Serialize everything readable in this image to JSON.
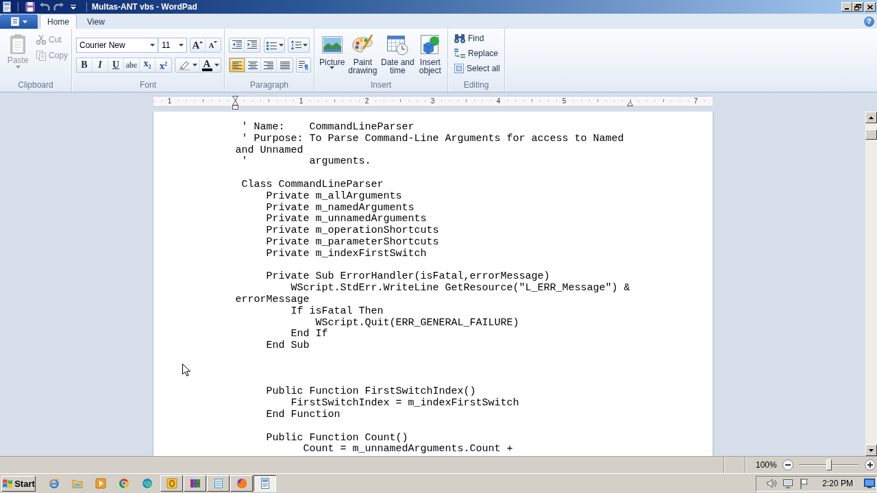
{
  "window": {
    "title": "Multas-ANT vbs - WordPad"
  },
  "quick_access": [
    {
      "kind": "save",
      "disabled": false
    },
    {
      "kind": "undo",
      "disabled": true
    },
    {
      "kind": "redo",
      "disabled": true
    }
  ],
  "ribbon": {
    "tabs": [
      {
        "label": "Home",
        "selected": true
      },
      {
        "label": "View",
        "selected": false
      }
    ],
    "help": "?",
    "clipboard": {
      "label": "Clipboard",
      "paste": {
        "label": "Paste",
        "disabled": true
      },
      "items": [
        {
          "kind": "cut",
          "label": "Cut",
          "disabled": true
        },
        {
          "kind": "copy",
          "label": "Copy",
          "disabled": true
        }
      ]
    },
    "font": {
      "label": "Font",
      "family": "Courier New",
      "size": "11",
      "grow_font": "A",
      "shrink_font": "A",
      "styles": [
        {
          "kind": "bold",
          "label": "B"
        },
        {
          "kind": "italic",
          "label": "I"
        },
        {
          "kind": "underline",
          "label": "U"
        },
        {
          "kind": "strike",
          "label": "abc"
        },
        {
          "kind": "subscript",
          "label": "x$_{2}$"
        },
        {
          "kind": "superscript",
          "label": "x$^{2}$"
        }
      ],
      "font_color": "A"
    },
    "paragraph": {
      "label": "Paragraph",
      "alignments": [
        {
          "kind": "left",
          "selected": true
        },
        {
          "kind": "center",
          "selected": false
        },
        {
          "kind": "right",
          "selected": false
        },
        {
          "kind": "justify",
          "selected": false
        }
      ]
    },
    "insert": {
      "label": "Insert",
      "items": [
        {
          "kind": "picture",
          "label": "Picture"
        },
        {
          "kind": "paint",
          "label": "Paint drawing"
        },
        {
          "kind": "datetime",
          "label": "Date and time"
        },
        {
          "kind": "object",
          "label": "Insert object"
        }
      ]
    },
    "editing": {
      "label": "Editing",
      "items": [
        {
          "kind": "find",
          "label": "Find"
        },
        {
          "kind": "replace",
          "label": "Replace"
        },
        {
          "kind": "select_all",
          "label": "Select all"
        }
      ]
    }
  },
  "ruler": {
    "marks": [
      "1",
      "1",
      "2",
      "3",
      "4",
      "5",
      "7"
    ]
  },
  "document": {
    "lines": [
      {
        "kind": "code",
        "text": " ' Name:    CommandLineParser"
      },
      {
        "kind": "code",
        "text": " ' Purpose: To Parse Command-Line Arguments for access to Named"
      },
      {
        "kind": "code",
        "text": "and Unnamed"
      },
      {
        "kind": "code",
        "text": " '          arguments."
      },
      {
        "kind": "blank"
      },
      {
        "kind": "code",
        "text": " Class CommandLineParser"
      },
      {
        "kind": "code",
        "text": "     Private m_allArguments"
      },
      {
        "kind": "code",
        "text": "     Private m_namedArguments"
      },
      {
        "kind": "code",
        "text": "     Private m_unnamedArguments"
      },
      {
        "kind": "code",
        "text": "     Private m_operationShortcuts"
      },
      {
        "kind": "code",
        "text": "     Private m_parameterShortcuts"
      },
      {
        "kind": "code",
        "text": "     Private m_indexFirstSwitch"
      },
      {
        "kind": "blank"
      },
      {
        "kind": "code",
        "text": "     Private Sub ErrorHandler(isFatal,errorMessage)"
      },
      {
        "kind": "code",
        "text": "         WScript.StdErr.WriteLine GetResource(\"L_ERR_Message\") &"
      },
      {
        "kind": "code",
        "text": "errorMessage"
      },
      {
        "kind": "code",
        "text": "         If isFatal Then"
      },
      {
        "kind": "code",
        "text": "             WScript.Quit(ERR_GENERAL_FAILURE)"
      },
      {
        "kind": "code",
        "text": "         End If"
      },
      {
        "kind": "code",
        "text": "     End Sub"
      },
      {
        "kind": "blank"
      },
      {
        "kind": "blank"
      },
      {
        "kind": "blank"
      },
      {
        "kind": "code",
        "text": "     Public Function FirstSwitchIndex()"
      },
      {
        "kind": "code",
        "text": "         FirstSwitchIndex = m_indexFirstSwitch"
      },
      {
        "kind": "code",
        "text": "     End Function"
      },
      {
        "kind": "blank"
      },
      {
        "kind": "code",
        "text": "     Public Function Count()"
      },
      {
        "kind": "code",
        "text": "           Count = m_unnamedArguments.Count +"
      }
    ]
  },
  "status_bar": {
    "zoom": "100%",
    "zoom_slider": {
      "level": 0.5
    }
  },
  "taskbar": {
    "start": "Start",
    "tasks": [
      {
        "selected": false
      },
      {
        "selected": false
      },
      {
        "selected": false
      },
      {
        "selected": false
      },
      {
        "selected": true
      }
    ],
    "clock": "2:20 PM"
  }
}
